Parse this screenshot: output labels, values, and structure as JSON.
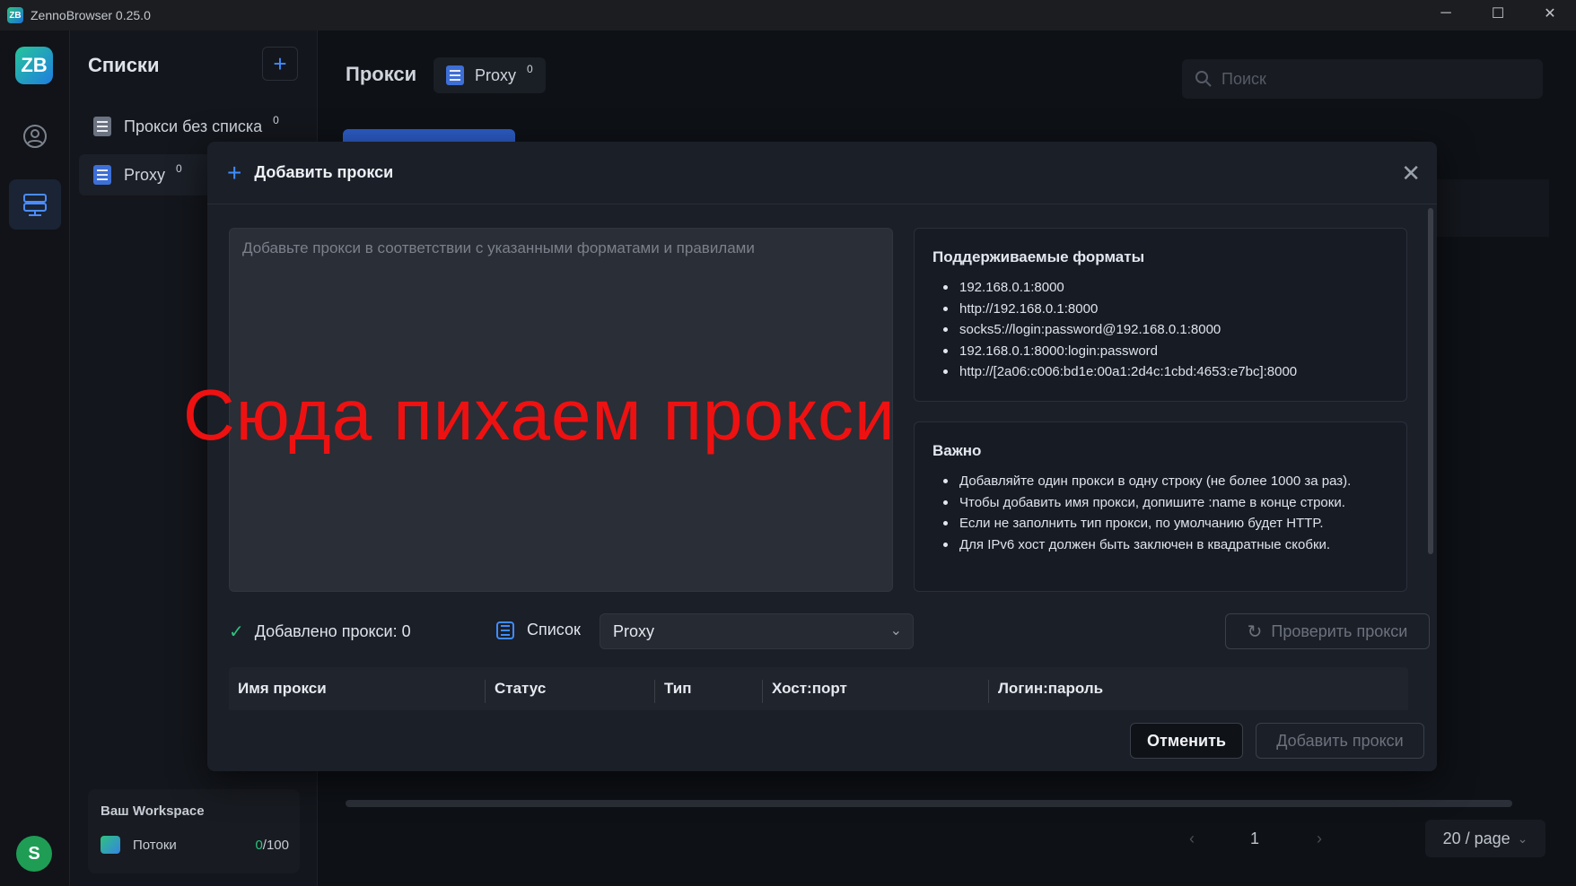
{
  "window": {
    "title": "ZennoBrowser 0.25.0",
    "logo": "ZB"
  },
  "rail": {
    "brand": "ZB",
    "avatar_letter": "S"
  },
  "lists": {
    "heading": "Списки",
    "items": [
      {
        "label": "Прокси без списка",
        "count": "0",
        "color": "#6b7280"
      },
      {
        "label": "Proxy",
        "count": "0",
        "color": "#3d6fd6"
      }
    ],
    "workspace": {
      "title": "Ваш Workspace",
      "streams_label": "Потоки",
      "streams_used": "0",
      "streams_total": "/100"
    }
  },
  "main": {
    "title": "Прокси",
    "chip": {
      "label": "Proxy",
      "count": "0"
    },
    "search_placeholder": "Поиск",
    "pager": {
      "prev": "‹",
      "page": "1",
      "next": "›",
      "size": "20 / page"
    }
  },
  "modal": {
    "title": "Добавить прокси",
    "textarea_placeholder": "Добавьте прокси в соответствии с указанными форматами и правилами",
    "overlay_text": "Сюда пихаем прокси",
    "formats": {
      "heading": "Поддерживаемые форматы",
      "items": [
        "192.168.0.1:8000",
        "http://192.168.0.1:8000",
        "socks5://login:password@192.168.0.1:8000",
        "192.168.0.1:8000:login:password",
        "http://[2a06:c006:bd1e:00a1:2d4c:1cbd:4653:e7bc]:8000"
      ]
    },
    "important": {
      "heading": "Важно",
      "items": [
        "Добавляйте один прокси в одну строку (не более 1000 за раз).",
        "Чтобы добавить имя прокси, допишите :name в конце строки.",
        "Если не заполнить тип прокси, по умолчанию будет HTTP.",
        "Для IPv6 хост должен быть заключен в квадратные скобки."
      ]
    },
    "added_label": "Добавлено прокси: 0",
    "list_label": "Список",
    "list_value": "Proxy",
    "check_button": "Проверить прокси",
    "columns": [
      "Имя прокси",
      "Статус",
      "Тип",
      "Хост:порт",
      "Логин:пароль"
    ],
    "cancel_button": "Отменить",
    "add_button": "Добавить прокси"
  },
  "colors": {
    "accent": "#3f8cff",
    "success": "#2ec27e",
    "overlay_red": "#ee1111"
  }
}
